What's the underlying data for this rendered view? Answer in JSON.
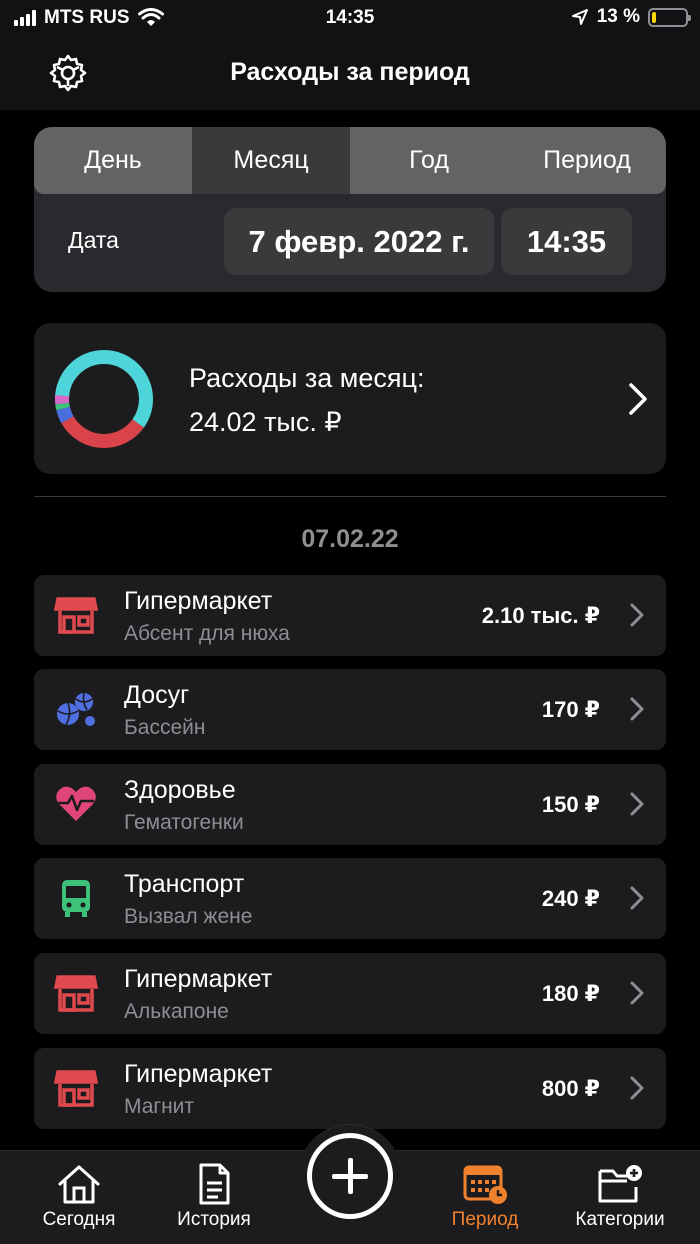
{
  "status_bar": {
    "carrier": "MTS RUS",
    "time": "14:35",
    "battery_text": "13 %",
    "battery_level": 0.13,
    "battery_color": "#ffd60a"
  },
  "header": {
    "title": "Расходы за период"
  },
  "period_selector": {
    "segments": [
      "День",
      "Месяц",
      "Год",
      "Период"
    ],
    "selected": "Месяц"
  },
  "date_row": {
    "label": "Дата",
    "date": "7 февр. 2022 г.",
    "time": "14:35"
  },
  "summary": {
    "title": "Расходы за месяц:",
    "amount": "24.02 тыс. ₽",
    "chart_colors": [
      "#4dd5d9",
      "#d9434a",
      "#4a6fdc",
      "#3cc279",
      "#d868c8"
    ]
  },
  "list": {
    "date_header": "07.02.22",
    "items": [
      {
        "category": "Гипермаркет",
        "note": "Абсент для нюха",
        "amount": "2.10 тыс. ₽",
        "icon": "store-icon",
        "color": "#e04a4f"
      },
      {
        "category": "Досуг",
        "note": "Бассейн",
        "amount": "170 ₽",
        "icon": "balls-icon",
        "color": "#4f6fe0"
      },
      {
        "category": "Здоровье",
        "note": "Гематогенки",
        "amount": "150 ₽",
        "icon": "heartbeat-icon",
        "color": "#e0457a"
      },
      {
        "category": "Транспорт",
        "note": "Вызвал жене",
        "amount": "240 ₽",
        "icon": "bus-icon",
        "color": "#3cc279"
      },
      {
        "category": "Гипермаркет",
        "note": "Алькапоне",
        "amount": "180 ₽",
        "icon": "store-icon",
        "color": "#e04a4f"
      },
      {
        "category": "Гипермаркет",
        "note": "Магнит",
        "amount": "800 ₽",
        "icon": "store-icon",
        "color": "#e04a4f"
      }
    ]
  },
  "tab_bar": {
    "tabs": [
      {
        "label": "Сегодня",
        "icon": "house-icon"
      },
      {
        "label": "История",
        "icon": "document-icon"
      },
      {
        "label": "Период",
        "icon": "calendar-clock-icon"
      },
      {
        "label": "Категории",
        "icon": "folder-add-icon"
      }
    ],
    "add_icon": "plus-icon",
    "active": "Период",
    "active_color": "#f0822e"
  }
}
